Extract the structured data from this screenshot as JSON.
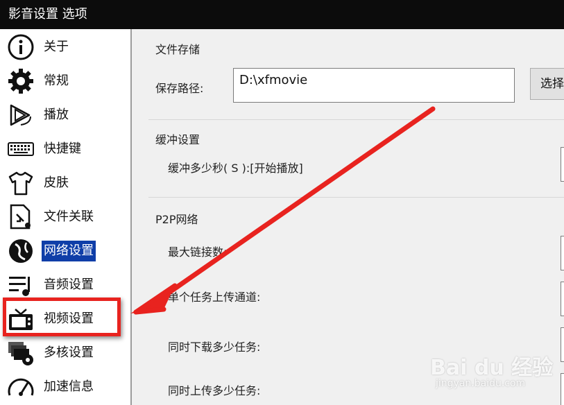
{
  "window": {
    "title": "影音设置 选项"
  },
  "sidebar": {
    "items": [
      {
        "label": "关于",
        "icon": "info-icon"
      },
      {
        "label": "常规",
        "icon": "gear-icon"
      },
      {
        "label": "播放",
        "icon": "play-icon"
      },
      {
        "label": "快捷键",
        "icon": "keyboard-icon"
      },
      {
        "label": "皮肤",
        "icon": "shirt-icon"
      },
      {
        "label": "文件关联",
        "icon": "file-link-icon"
      },
      {
        "label": "网络设置",
        "icon": "network-icon",
        "selected": true
      },
      {
        "label": "音频设置",
        "icon": "audio-icon"
      },
      {
        "label": "视频设置",
        "icon": "tv-icon"
      },
      {
        "label": "多核设置",
        "icon": "multicore-icon"
      },
      {
        "label": "加速信息",
        "icon": "speedometer-icon"
      }
    ]
  },
  "content": {
    "storage": {
      "title": "文件存储",
      "path_label": "保存路径:",
      "path_value": "D:\\xfmovie",
      "choose_button": "选择"
    },
    "buffer": {
      "title": "缓冲设置",
      "seconds_label": "缓冲多少秒( S ):[开始播放]"
    },
    "p2p": {
      "title": "P2P网络",
      "max_links_label": "最大链接数:",
      "upload_channels_label": "单个任务上传通道:",
      "concurrent_downloads_label": "同时下载多少任务:",
      "concurrent_uploads_label": "同时上传多少任务:"
    }
  },
  "watermark": {
    "logo": "Bai du 经验",
    "url": "jingyan.baidu.com"
  },
  "colors": {
    "selected": "#0f3ea8",
    "highlight": "#e8231f",
    "titlebar": "#0c0c0c"
  }
}
